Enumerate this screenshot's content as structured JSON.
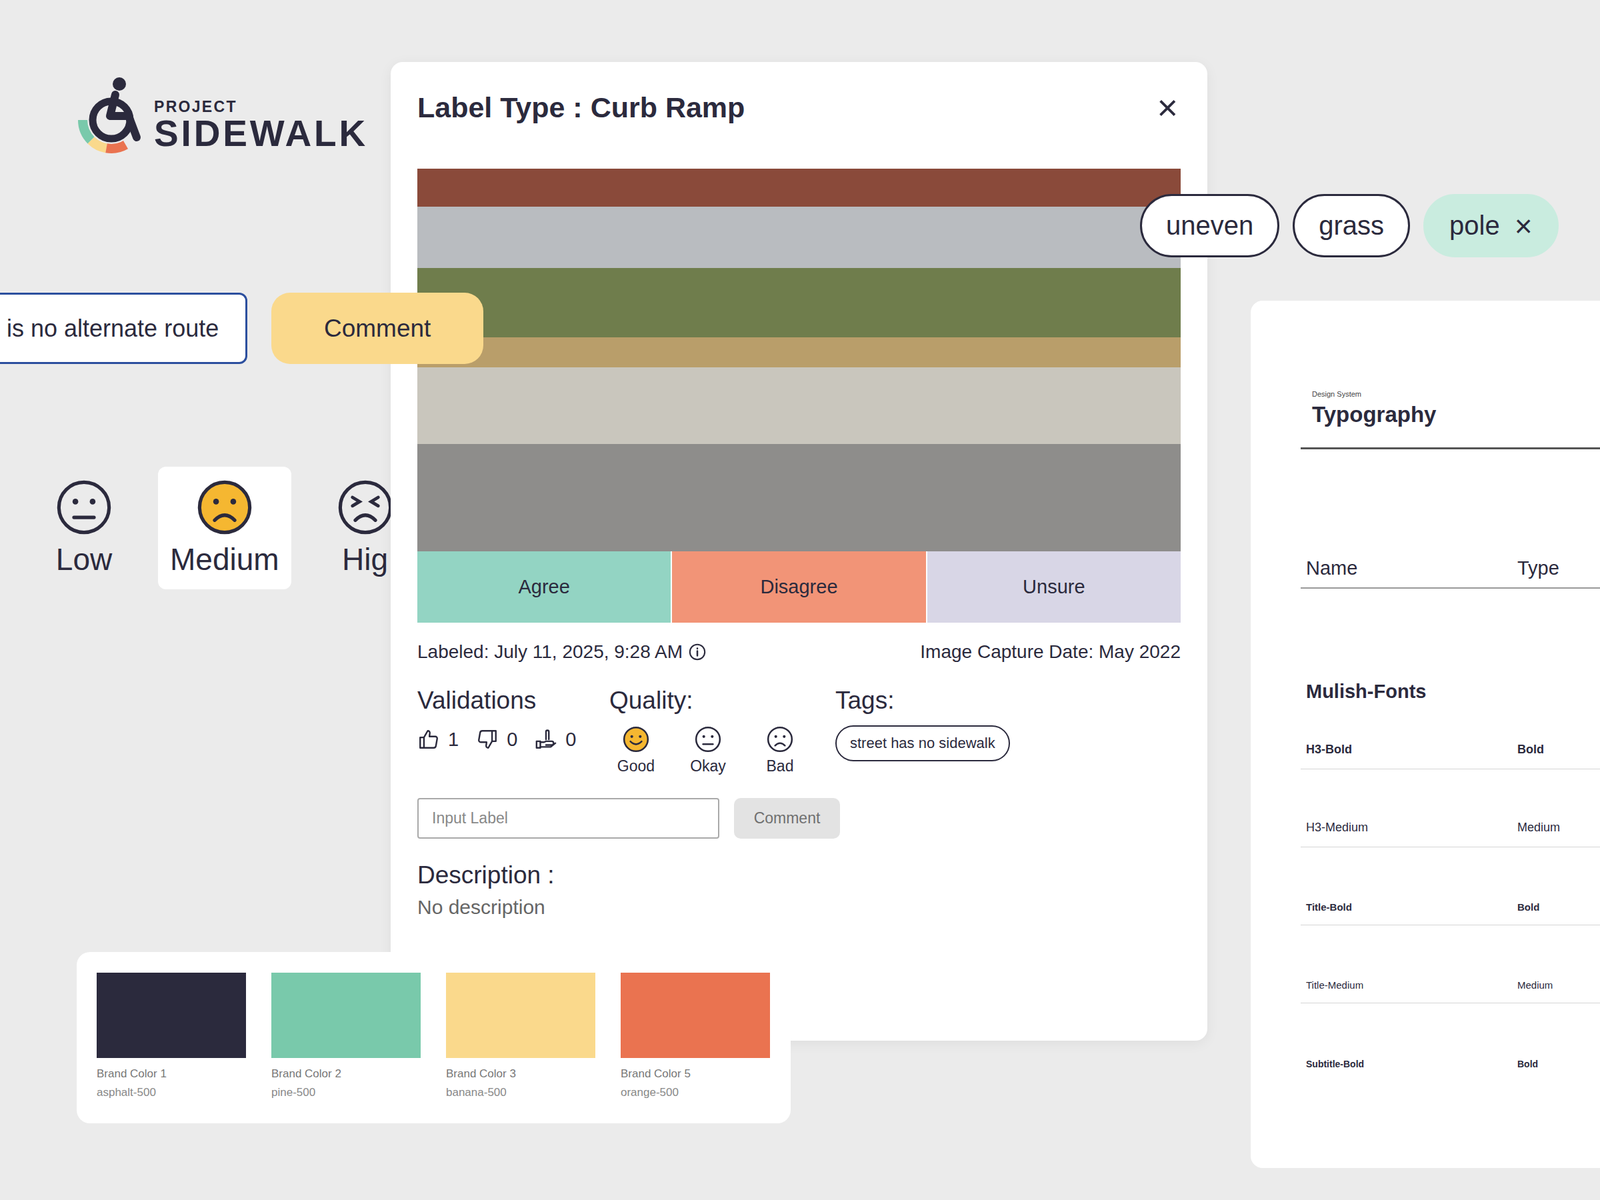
{
  "logo": {
    "line1": "PROJECT",
    "line2": "SIDEWALK"
  },
  "route_field": {
    "value": "is no alternate route"
  },
  "comment_button": {
    "label": "Comment"
  },
  "severity": [
    {
      "label": "Low",
      "kind": "neutral",
      "selected": false
    },
    {
      "label": "Medium",
      "kind": "frown",
      "selected": true
    },
    {
      "label": "Hig",
      "kind": "angry",
      "selected": false
    }
  ],
  "tag_chips": {
    "remove_glyph": "×",
    "items": [
      {
        "label": "uneven",
        "selected": false
      },
      {
        "label": "grass",
        "selected": false
      },
      {
        "label": "pole",
        "selected": true
      }
    ]
  },
  "modal": {
    "title": "Label Type : Curb Ramp",
    "close": "×",
    "actions": [
      {
        "label": "Agree",
        "color": "#93d4c3"
      },
      {
        "label": "Disagree",
        "color": "#f29477"
      },
      {
        "label": "Unsure",
        "color": "#d8d6e6"
      }
    ],
    "labeled": "Labeled: July 11, 2025, 9:28 AM",
    "capture": "Image Capture Date: May 2022",
    "validations": {
      "title": "Validations",
      "counts": [
        {
          "kind": "agree",
          "value": "1"
        },
        {
          "kind": "disagree",
          "value": "0"
        },
        {
          "kind": "unsure",
          "value": "0"
        }
      ]
    },
    "quality": {
      "title": "Quality:",
      "options": [
        {
          "label": "Good",
          "kind": "smile",
          "selected": true
        },
        {
          "label": "Okay",
          "kind": "neutral",
          "selected": false
        },
        {
          "label": "Bad",
          "kind": "frown",
          "selected": false
        }
      ]
    },
    "tags": {
      "title": "Tags:",
      "items": [
        "street has no sidewalk"
      ]
    },
    "comment": {
      "placeholder": "Input Label",
      "button": "Comment",
      "disabled": true
    },
    "description": {
      "title": "Description :",
      "text": "No description"
    }
  },
  "palette": [
    {
      "name": "Brand Color 1",
      "token": "asphalt-500",
      "color": "#2b2a3d"
    },
    {
      "name": "Brand Color 2",
      "token": "pine-500",
      "color": "#79c9ab"
    },
    {
      "name": "Brand Color 3",
      "token": "banana-500",
      "color": "#fad98c"
    },
    {
      "name": "Brand Color 5",
      "token": "orange-500",
      "color": "#ea7350"
    }
  ],
  "typography": {
    "eyebrow": "Design System",
    "title": "Typography",
    "columns": [
      "Name",
      "Type"
    ],
    "family": "Mulish-Fonts",
    "rows": [
      {
        "name": "H3-Bold",
        "type": "Bold",
        "kind": "h3-bold"
      },
      {
        "name": "H3-Medium",
        "type": "Medium",
        "kind": "h3-medium"
      },
      {
        "name": "Title-Bold",
        "type": "Bold",
        "kind": "title-bold"
      },
      {
        "name": "Title-Medium",
        "type": "Medium",
        "kind": "title-medium"
      },
      {
        "name": "Subtitle-Bold",
        "type": "Bold",
        "kind": "subtitle-bold"
      }
    ]
  }
}
